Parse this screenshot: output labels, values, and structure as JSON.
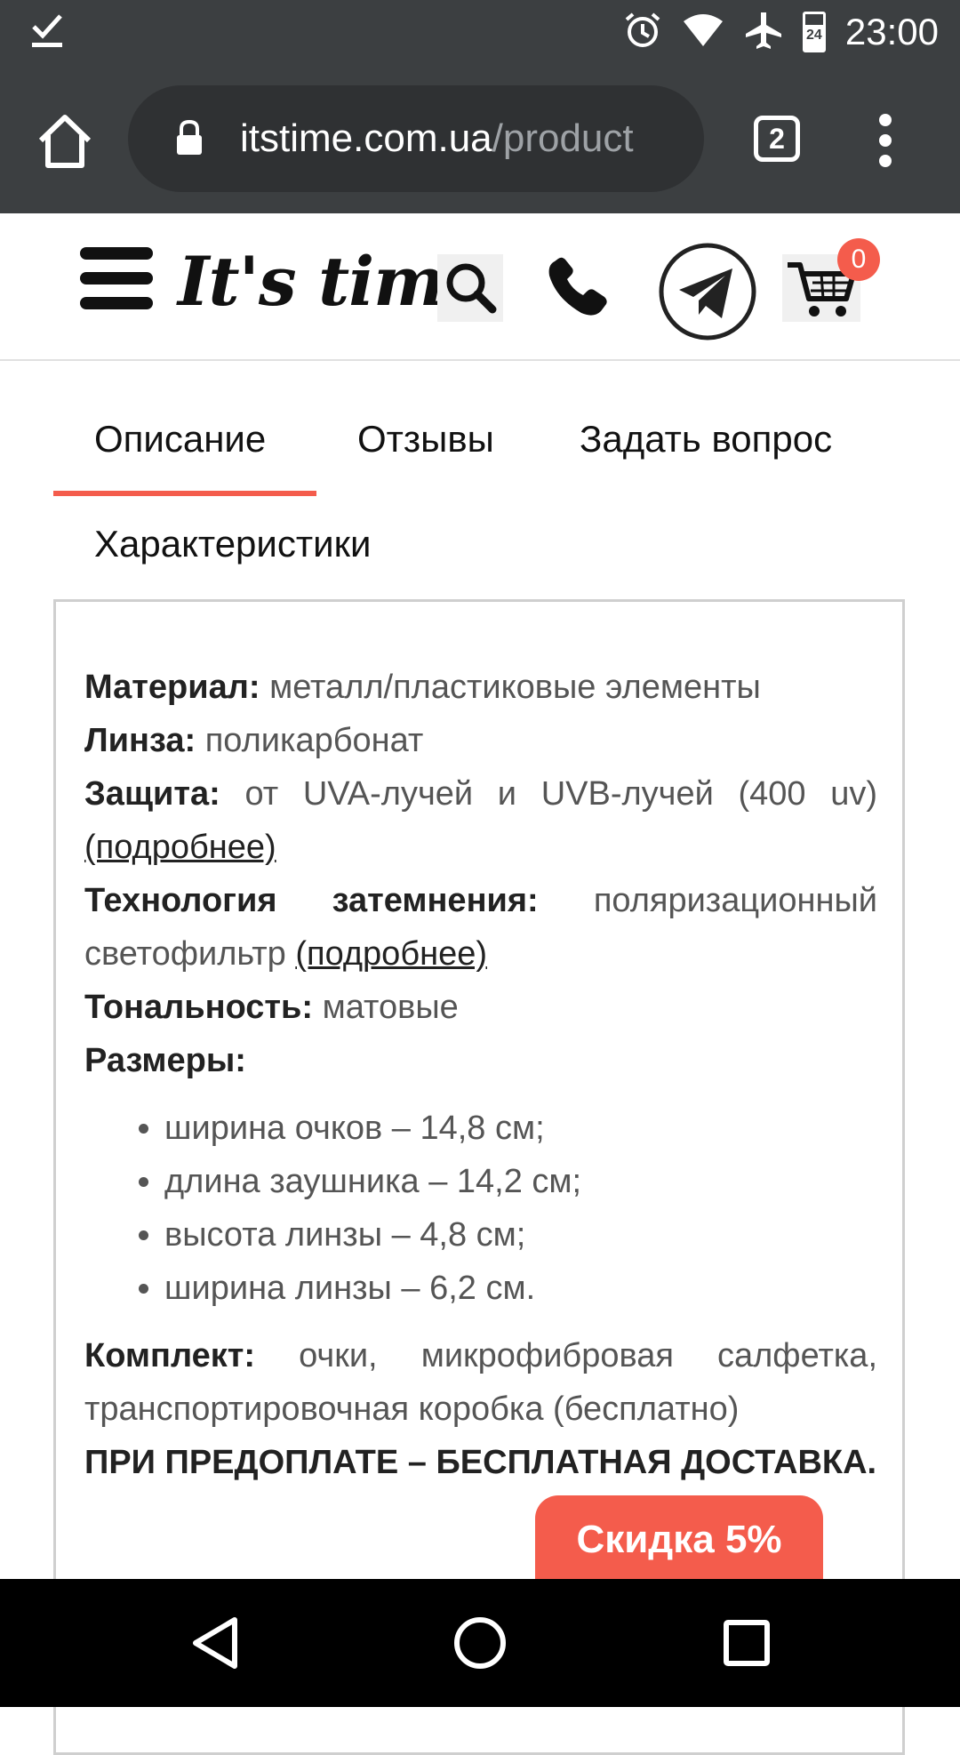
{
  "status_bar": {
    "time": "23:00",
    "battery_level": "24"
  },
  "browser": {
    "url_domain": "itstime.com.ua",
    "url_path": "/product",
    "tab_count": "2"
  },
  "site_header": {
    "logo": "It's time",
    "cart_count": "0"
  },
  "tabs": {
    "description": "Описание",
    "reviews": "Отзывы",
    "ask": "Задать вопрос",
    "specs": "Характеристики"
  },
  "specs": {
    "material_label": "Материал:",
    "material_value": "металл/пластиковые элементы",
    "lens_label": "Линза:",
    "lens_value": "поликарбонат",
    "protection_label": "Защита:",
    "protection_value": "от UVA-лучей и UVB-лучей (400 uv)",
    "protection_link": "(подробнее)",
    "tech_label": "Технология затемнения:",
    "tech_value": "поляризационный светофильтр",
    "tech_link": "(подробнее)",
    "tone_label": "Тональность:",
    "tone_value": "матовые",
    "sizes_label": "Размеры:",
    "sizes": [
      "ширина очков – 14,8 см;",
      "длина заушника – 14,2 см;",
      "высота линзы – 4,8 см;",
      "ширина линзы – 6,2 см."
    ],
    "kit_label": "Комплект:",
    "kit_value": "очки, микрофибровая салфетка, транспортировочная коробка (бесплатно)",
    "delivery_note": "ПРИ ПРЕДОПЛАТЕ – БЕСПЛАТНАЯ ДОСТАВКА."
  },
  "discount_button": "Скидка 5%"
}
